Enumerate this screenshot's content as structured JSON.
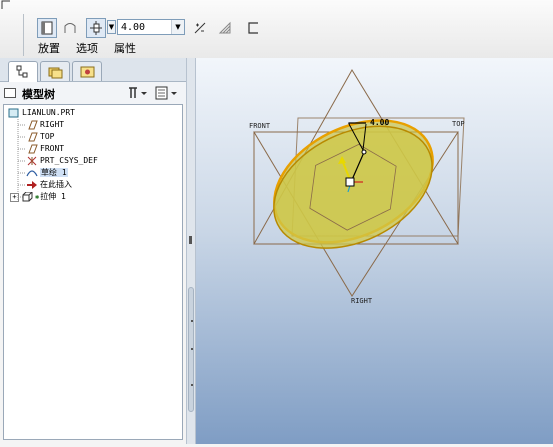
{
  "ribbon": {
    "tabs": [
      {
        "label": "放置"
      },
      {
        "label": "选项"
      },
      {
        "label": "属性"
      }
    ],
    "depth_value": "4.00"
  },
  "tree": {
    "title": "模型树",
    "items": [
      {
        "label": "LIANLUN.PRT",
        "icon": "part-icon"
      },
      {
        "label": "RIGHT",
        "icon": "datum-plane-icon"
      },
      {
        "label": "TOP",
        "icon": "datum-plane-icon"
      },
      {
        "label": "FRONT",
        "icon": "datum-plane-icon"
      },
      {
        "label": "PRT_CSYS_DEF",
        "icon": "csys-icon"
      },
      {
        "label": "草绘 1",
        "icon": "sketch-icon"
      },
      {
        "label": "在此插入",
        "icon": "insert-here-arrow-icon"
      },
      {
        "label": "拉伸 1",
        "icon": "extrude-icon"
      }
    ]
  },
  "viewport": {
    "plane_labels": {
      "front": "FRONT",
      "top": "TOP",
      "right": "RIGHT"
    },
    "dimension": "4.00"
  },
  "colors": {
    "accent": "#e8a000",
    "ellipse_fill": "#c9c23a",
    "datum": "#8a6a4a"
  }
}
